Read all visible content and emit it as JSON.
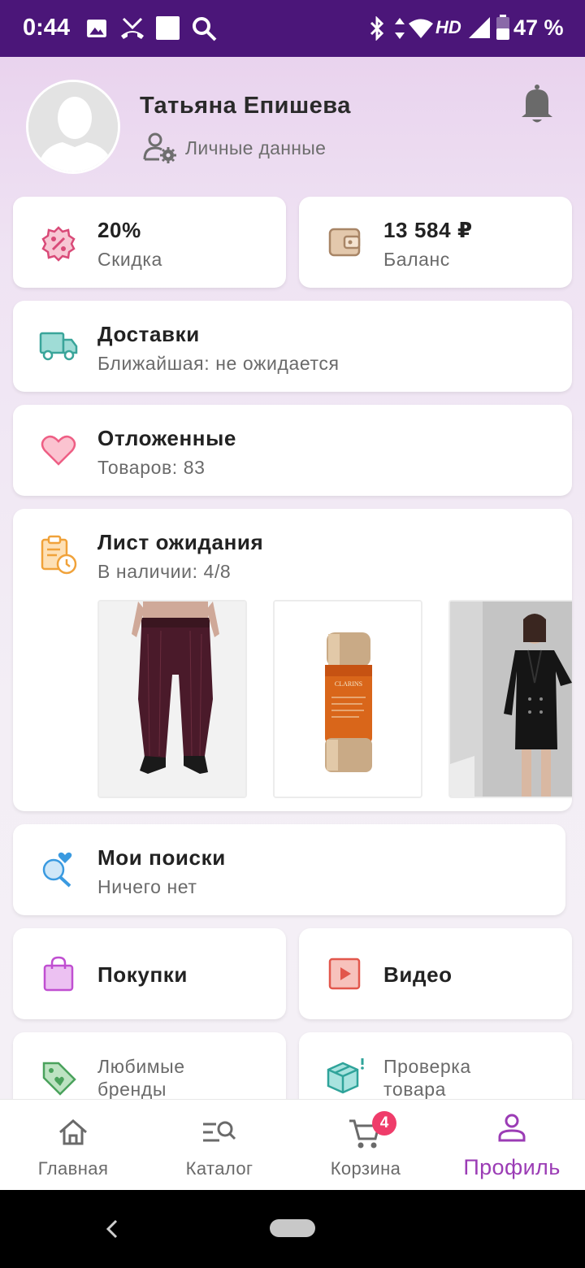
{
  "status_bar": {
    "time": "0:44",
    "network": "HD",
    "battery": "47 %"
  },
  "profile": {
    "name": "Татьяна Епишева",
    "personal_data_label": "Личные данные"
  },
  "discount": {
    "value": "20%",
    "label": "Скидка"
  },
  "balance": {
    "value": "13 584 ₽",
    "label": "Баланс"
  },
  "deliveries": {
    "title": "Доставки",
    "subtitle": "Ближайшая: не ожидается"
  },
  "saved": {
    "title": "Отложенные",
    "subtitle": "Товаров: 83"
  },
  "waitlist": {
    "title": "Лист ожидания",
    "subtitle": "В наличии: 4/8",
    "products": [
      "trousers-image",
      "serum-bottle-image",
      "blazer-dress-image"
    ],
    "serum_brand": "CLARINS"
  },
  "searches": {
    "title": "Мои поиски",
    "subtitle": "Ничего нет"
  },
  "purchases": {
    "title": "Покупки"
  },
  "video": {
    "title": "Видео"
  },
  "brands": {
    "title_line1": "Любимые",
    "title_line2": "бренды"
  },
  "check": {
    "title_line1": "Проверка",
    "title_line2": "товара"
  },
  "nav": {
    "items": [
      {
        "label": "Главная",
        "icon": "home-icon"
      },
      {
        "label": "Каталог",
        "icon": "catalog-search-icon"
      },
      {
        "label": "Корзина",
        "icon": "cart-icon",
        "badge": "4"
      },
      {
        "label": "Профиль",
        "icon": "profile-icon",
        "active": true
      }
    ]
  },
  "colors": {
    "status_bar": "#4b1679",
    "accent": "#9b3cb5",
    "badge": "#ef3c6a"
  }
}
